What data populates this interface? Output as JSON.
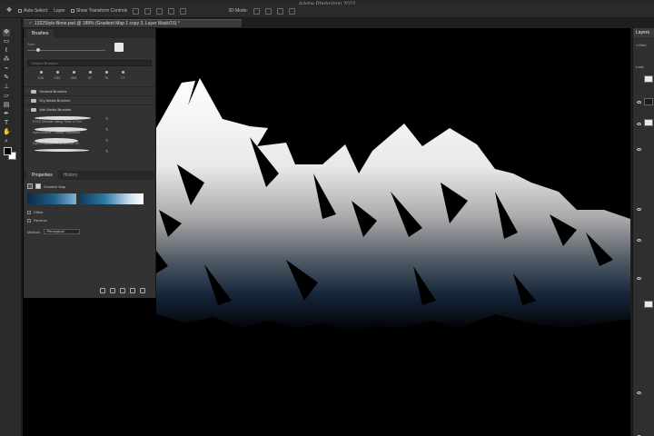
{
  "window": {
    "app_title": "Adobe Photoshop 2022"
  },
  "options_bar": {
    "auto_select_label": "Auto-Select:",
    "auto_select_value": "Layer",
    "transform_label": "Show Transform Controls",
    "mode_label": "3D Mode:"
  },
  "document_tab": {
    "title": "1322Style-Bone.psd @ 189% (Gradient Map 1 copy 3, Layer Mask/16) *"
  },
  "brushes_panel": {
    "tab_label": "Brushes",
    "size_label": "Size:",
    "search_placeholder": "Search Brushes",
    "presets": [
      "100",
      "150",
      "300",
      "37",
      "75",
      "77"
    ],
    "folders": [
      "General Brushes",
      "Dry Media Brushes",
      "Wet Media Brushes"
    ],
    "brushes": [
      "KYLE Ultimate Inking Thick 'n Thin",
      "Kyle's Inkbox - Classic Cartoonist",
      "Kyle's Paintbox - Wet Blender 50",
      ""
    ]
  },
  "properties_panel": {
    "tabs": [
      "Properties",
      "History"
    ],
    "title": "Gradient Map",
    "dither_label": "Dither",
    "reverse_label": "Reverse",
    "method_label": "Method:",
    "method_value": "Perceptual"
  },
  "layers_panel": {
    "tab_label": "Layers",
    "kind_label": "Kind",
    "lock_label": "Lock:"
  },
  "colors": {
    "canvas": "#000000",
    "panel": "#323232",
    "gradient_dark": "#0b2a45",
    "gradient_mid": "#2d7ba8",
    "gradient_light": "#cfe3ef"
  },
  "icons": [
    "move-icon",
    "marquee-icon",
    "lasso-icon",
    "brush-icon",
    "eraser-icon",
    "gradient-icon",
    "zoom-icon",
    "hand-icon",
    "eye-icon"
  ]
}
